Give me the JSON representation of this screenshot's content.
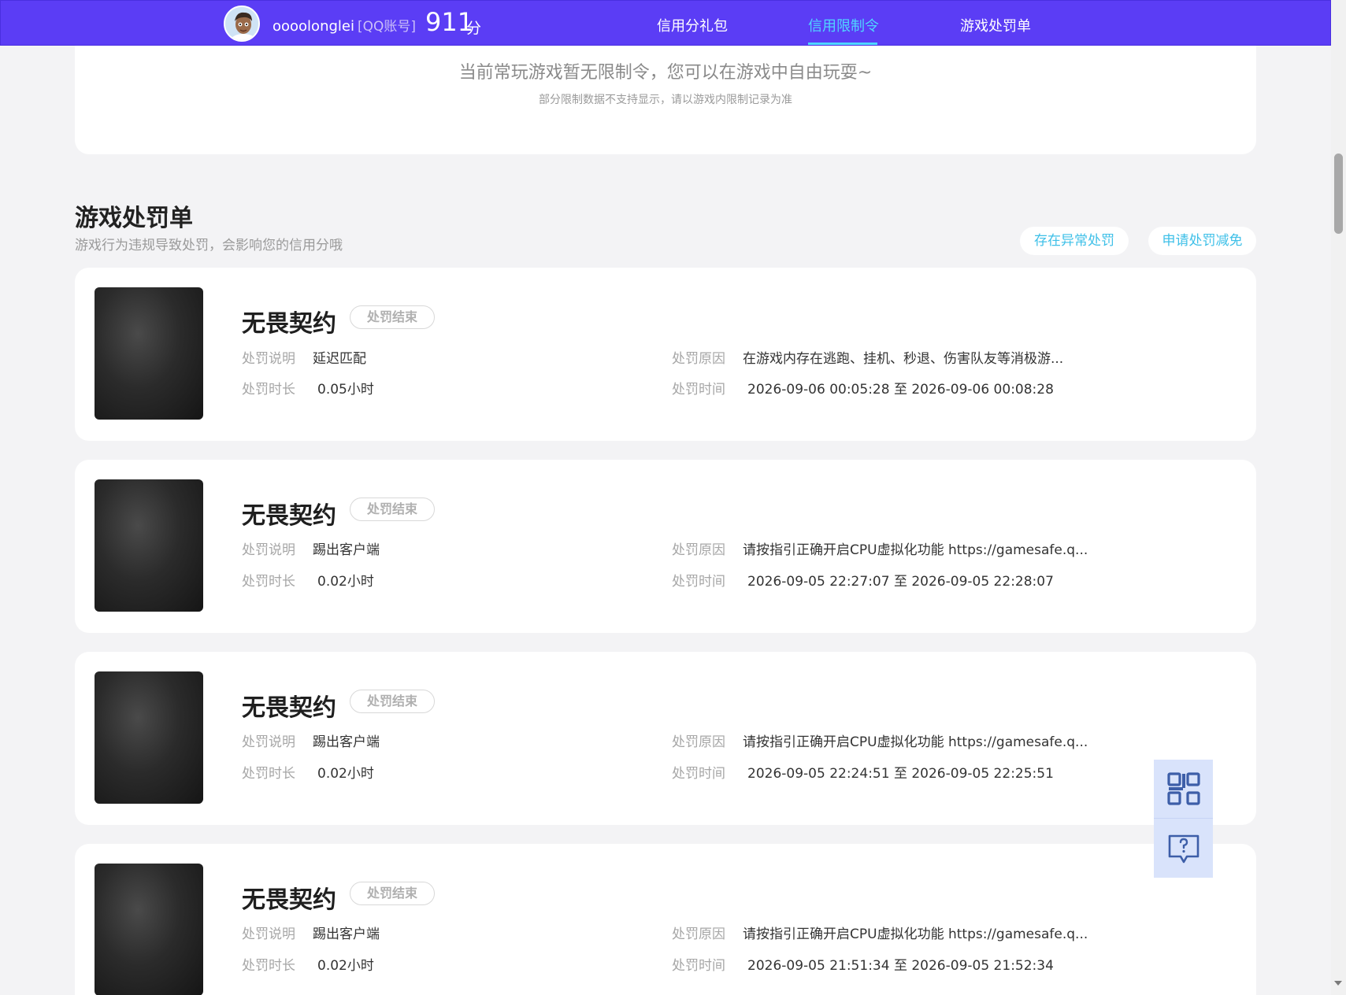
{
  "header": {
    "username": "oooolonglei",
    "account_type": "[QQ账号]",
    "score": "911",
    "score_unit": "分",
    "tabs": [
      {
        "label": "信用分礼包"
      },
      {
        "label": "信用限制令"
      },
      {
        "label": "游戏处罚单"
      }
    ],
    "active_tab": "信用限制令",
    "accent_color": "#5b3df5"
  },
  "restriction": {
    "message": "当前常玩游戏暂无限制令，您可以在游戏中自由玩耍~",
    "note": "部分限制数据不支持显示，请以游戏内限制记录为准"
  },
  "penalty_section": {
    "title": "游戏处罚单",
    "description": "游戏行为违规导致处罚，会影响您的信用分哦",
    "btn_abnormal": "存在异常处罚",
    "btn_reduce": "申请处罚减免"
  },
  "field_labels": {
    "desc": "处罚说明",
    "duration": "处罚时长",
    "reason": "处罚原因",
    "time": "处罚时间"
  },
  "records": [
    {
      "game": "无畏契约",
      "status": "处罚结束",
      "desc": "延迟匹配",
      "duration": "0.05小时",
      "reason": "在游戏内存在逃跑、挂机、秒退、伤害队友等消极游...",
      "time": "2026-09-06 00:05:28 至 2026-09-06 00:08:28"
    },
    {
      "game": "无畏契约",
      "status": "处罚结束",
      "desc": "踢出客户端",
      "duration": "0.02小时",
      "reason": "请按指引正确开启CPU虚拟化功能 https://gamesafe.q...",
      "time": "2026-09-05 22:27:07 至 2026-09-05 22:28:07"
    },
    {
      "game": "无畏契约",
      "status": "处罚结束",
      "desc": "踢出客户端",
      "duration": "0.02小时",
      "reason": "请按指引正确开启CPU虚拟化功能 https://gamesafe.q...",
      "time": "2026-09-05 22:24:51 至 2026-09-05 22:25:51"
    },
    {
      "game": "无畏契约",
      "status": "处罚结束",
      "desc": "踢出客户端",
      "duration": "0.02小时",
      "reason": "请按指引正确开启CPU虚拟化功能 https://gamesafe.q...",
      "time": "2026-09-05 21:51:34 至 2026-09-05 21:52:34"
    }
  ],
  "float_tools": [
    {
      "icon": "qr-code-icon"
    },
    {
      "icon": "help-chat-icon"
    }
  ]
}
